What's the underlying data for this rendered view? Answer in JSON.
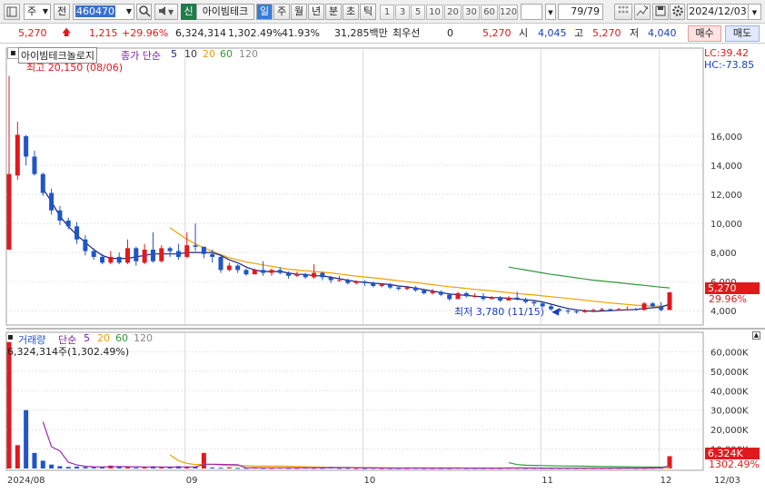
{
  "toolbar": {
    "market": "주",
    "prev": "전",
    "code": "460470",
    "credit": "신",
    "name": "아이빔테크",
    "periods": [
      "일",
      "주",
      "월",
      "년",
      "분",
      "초",
      "틱"
    ],
    "active_period": "일",
    "intervals": [
      "1",
      "3",
      "5",
      "10",
      "20",
      "30",
      "60",
      "120"
    ],
    "count": "79",
    "total": "/79",
    "date": "2024/12/03",
    "colors": {
      "accent": "#1a6fd8",
      "period_active": "#3b7bd6"
    }
  },
  "quote": {
    "price": "5,270",
    "change": "1,215",
    "change_pct": "+29.96%",
    "volume": "6,324,314",
    "volume_pct": "1,302.49%",
    "turnover": "41.93%",
    "amount": "31,285백만",
    "pref_label": "최우선",
    "pref_value": "0",
    "ask": "5,270",
    "open_label": "시",
    "open": "4,045",
    "high_label": "고",
    "high": "5,270",
    "low_label": "저",
    "low": "4,040",
    "buy": "매수",
    "sell": "매도"
  },
  "price_panel": {
    "title": "아이빔테크놀로지",
    "ma_label": "종가 단순",
    "ma_periods": [
      "5",
      "10",
      "20",
      "60",
      "120"
    ],
    "high_note": "최고 20,150 (08/06)",
    "low_note": "최저 3,780 (11/15)",
    "lc": "LC:39.42",
    "hc": "HC:-73.85",
    "price_tag": "5,270",
    "pct_tag": "29.96%",
    "yticks": [
      "16,000",
      "14,000",
      "12,000",
      "10,000",
      "8,000",
      "6,000",
      "4,000"
    ]
  },
  "volume_panel": {
    "title": "거래량",
    "ma_label": "단순",
    "ma_periods": [
      "5",
      "20",
      "60",
      "120"
    ],
    "value_note": "6,324,314주(1,302.49%)",
    "vol_tag": "6,324K",
    "pct_tag": "1302.49%",
    "yticks": [
      "60,000K",
      "50,000K",
      "40,000K",
      "30,000K",
      "20,000K",
      "10,000K"
    ]
  },
  "xaxis": {
    "labels": [
      "2024/08",
      "09",
      "10",
      "11",
      "12",
      "12/03"
    ]
  },
  "chart_data": {
    "type": "candlestick",
    "x_range": [
      "2024/08",
      "2024/12/03"
    ],
    "ylim": [
      3200,
      21000
    ],
    "colors": {
      "up": "#e1191d",
      "down": "#1f55c7",
      "ma5": "#1a237e",
      "ma20": "#f0a000",
      "ma60": "#2e9a3a"
    },
    "candles": [
      [
        8200,
        13400,
        8200,
        20150
      ],
      [
        13300,
        16100,
        13000,
        17000
      ],
      [
        16000,
        14600,
        14000,
        16100
      ],
      [
        14600,
        13400,
        13300,
        15000
      ],
      [
        13400,
        12100,
        11900,
        13500
      ],
      [
        12100,
        10900,
        10600,
        12400
      ],
      [
        10900,
        10200,
        9900,
        11200
      ],
      [
        10200,
        9800,
        9600,
        10400
      ],
      [
        9800,
        8900,
        8600,
        10100
      ],
      [
        8900,
        8100,
        7800,
        9200
      ],
      [
        8100,
        7700,
        7500,
        8300
      ],
      [
        7700,
        7300,
        7200,
        7900
      ],
      [
        7300,
        7700,
        7200,
        8100
      ],
      [
        7700,
        7300,
        7200,
        8000
      ],
      [
        7300,
        8300,
        7200,
        8900
      ],
      [
        8300,
        7400,
        7100,
        8400
      ],
      [
        7300,
        8200,
        7200,
        8600
      ],
      [
        8200,
        7400,
        7300,
        9400
      ],
      [
        7400,
        8300,
        7300,
        8500
      ],
      [
        8300,
        8100,
        7700,
        8400
      ],
      [
        8100,
        7700,
        7500,
        8600
      ],
      [
        7700,
        8500,
        7600,
        9400
      ],
      [
        8500,
        8400,
        8100,
        10000
      ],
      [
        8400,
        7900,
        7600,
        8400
      ],
      [
        7900,
        7700,
        7300,
        8200
      ],
      [
        7700,
        6800,
        6600,
        7900
      ],
      [
        6800,
        7100,
        6700,
        7300
      ],
      [
        7100,
        6800,
        6600,
        7200
      ],
      [
        6800,
        6500,
        6400,
        6900
      ],
      [
        6500,
        6800,
        6500,
        6900
      ],
      [
        6800,
        6600,
        6400,
        7400
      ],
      [
        6600,
        6800,
        6400,
        6900
      ],
      [
        6800,
        6600,
        6500,
        7000
      ],
      [
        6600,
        6400,
        6200,
        6700
      ],
      [
        6400,
        6500,
        6300,
        6700
      ],
      [
        6500,
        6300,
        6200,
        6600
      ],
      [
        6300,
        6600,
        6200,
        7200
      ],
      [
        6600,
        6300,
        6100,
        6700
      ],
      [
        6300,
        6100,
        5900,
        6400
      ],
      [
        6100,
        6100,
        6000,
        6400
      ],
      [
        6100,
        5900,
        5800,
        6200
      ],
      [
        5900,
        6000,
        5800,
        6100
      ],
      [
        6000,
        5900,
        5700,
        6100
      ],
      [
        5900,
        5700,
        5600,
        6000
      ],
      [
        5700,
        5800,
        5600,
        5900
      ],
      [
        5800,
        5600,
        5500,
        5900
      ],
      [
        5600,
        5500,
        5400,
        5700
      ],
      [
        5500,
        5600,
        5400,
        5700
      ],
      [
        5600,
        5400,
        5300,
        5700
      ],
      [
        5400,
        5200,
        5100,
        5500
      ],
      [
        5200,
        5300,
        5100,
        5500
      ],
      [
        5300,
        5100,
        5000,
        5400
      ],
      [
        5100,
        4800,
        4700,
        5200
      ],
      [
        4800,
        5200,
        4800,
        5300
      ],
      [
        5200,
        5000,
        4900,
        5300
      ],
      [
        5000,
        5000,
        4900,
        5200
      ],
      [
        5000,
        4800,
        4700,
        5200
      ],
      [
        4800,
        4900,
        4800,
        5000
      ],
      [
        4900,
        4700,
        4600,
        5000
      ],
      [
        4700,
        4900,
        4700,
        5000
      ],
      [
        4900,
        4800,
        4700,
        5300
      ],
      [
        4800,
        4600,
        4500,
        4900
      ],
      [
        4600,
        4500,
        4300,
        4700
      ],
      [
        4500,
        4300,
        4200,
        4600
      ],
      [
        4300,
        4100,
        4000,
        4400
      ],
      [
        4100,
        4000,
        3900,
        4200
      ],
      [
        4000,
        3950,
        3780,
        4100
      ],
      [
        3950,
        3900,
        3800,
        4000
      ],
      [
        3900,
        4000,
        3850,
        4100
      ],
      [
        4000,
        4050,
        3950,
        4150
      ],
      [
        4050,
        4100,
        4000,
        4200
      ],
      [
        4100,
        4050,
        4000,
        4150
      ],
      [
        4050,
        4100,
        4000,
        4200
      ],
      [
        4100,
        4100,
        4000,
        4300
      ],
      [
        4100,
        4050,
        4000,
        4200
      ],
      [
        4050,
        4500,
        4000,
        4600
      ],
      [
        4500,
        4300,
        4200,
        4600
      ],
      [
        4300,
        4050,
        3950,
        4600
      ],
      [
        4045,
        5270,
        4040,
        5270
      ]
    ],
    "ma5": [
      null,
      null,
      null,
      null,
      12400,
      11500,
      10500,
      9800,
      9200,
      8700,
      8200,
      7800,
      7600,
      7600,
      7600,
      7700,
      7800,
      7900,
      7900,
      7900,
      7900,
      8000,
      8000,
      8000,
      8000,
      7800,
      7500,
      7300,
      7000,
      6800,
      6700,
      6700,
      6700,
      6600,
      6500,
      6500,
      6400,
      6400,
      6300,
      6200,
      6100,
      6000,
      5950,
      5900,
      5850,
      5800,
      5700,
      5650,
      5550,
      5450,
      5350,
      5250,
      5150,
      5100,
      5050,
      5000,
      4950,
      4900,
      4900,
      4850,
      4800,
      4750,
      4700,
      4600,
      4450,
      4300,
      4150,
      4050,
      4000,
      3950,
      3980,
      4000,
      4030,
      4060,
      4080,
      4150,
      4200,
      4250,
      4450
    ],
    "ma20": [
      null,
      null,
      null,
      null,
      null,
      null,
      null,
      null,
      null,
      null,
      null,
      null,
      null,
      null,
      null,
      null,
      null,
      null,
      null,
      9700,
      9300,
      8900,
      8600,
      8300,
      8100,
      7850,
      7650,
      7500,
      7350,
      7250,
      7150,
      7050,
      6950,
      6850,
      6800,
      6750,
      6700,
      6650,
      6600,
      6520,
      6450,
      6380,
      6320,
      6260,
      6200,
      6130,
      6060,
      6000,
      5930,
      5860,
      5790,
      5720,
      5650,
      5590,
      5530,
      5470,
      5420,
      5360,
      5300,
      5240,
      5180,
      5130,
      5080,
      5020,
      4960,
      4900,
      4840,
      4780,
      4720,
      4650,
      4590,
      4530,
      4480,
      4430,
      4380,
      4340,
      4320,
      4320,
      4380
    ],
    "ma60": [
      null,
      null,
      null,
      null,
      null,
      null,
      null,
      null,
      null,
      null,
      null,
      null,
      null,
      null,
      null,
      null,
      null,
      null,
      null,
      null,
      null,
      null,
      null,
      null,
      null,
      null,
      null,
      null,
      null,
      null,
      null,
      null,
      null,
      null,
      null,
      null,
      null,
      null,
      null,
      null,
      null,
      null,
      null,
      null,
      null,
      null,
      null,
      null,
      null,
      null,
      null,
      null,
      null,
      null,
      null,
      null,
      null,
      null,
      null,
      7000,
      6900,
      6800,
      6700,
      6600,
      6500,
      6420,
      6340,
      6260,
      6180,
      6100,
      6040,
      5980,
      5920,
      5860,
      5800,
      5740,
      5680,
      5620,
      5570
    ],
    "volume": {
      "ylim": [
        0,
        70000
      ],
      "values": [
        65000,
        12000,
        30000,
        8000,
        4000,
        2000,
        1200,
        800,
        1000,
        700,
        600,
        800,
        1500,
        800,
        700,
        400,
        600,
        1100,
        600,
        500,
        1200,
        700,
        800,
        8000,
        500,
        400,
        600,
        300,
        300,
        400,
        300,
        300,
        400,
        300,
        300,
        400,
        300,
        300,
        800,
        300,
        300,
        200,
        200,
        300,
        200,
        200,
        200,
        200,
        300,
        200,
        200,
        200,
        200,
        300,
        200,
        200,
        200,
        200,
        200,
        300,
        300,
        200,
        200,
        200,
        200,
        200,
        200,
        200,
        200,
        200,
        200,
        200,
        200,
        300,
        200,
        200,
        300,
        400,
        6324
      ],
      "ma5": [
        null,
        null,
        null,
        null,
        24000,
        11200,
        9000,
        3200,
        1800,
        1100,
        900,
        800,
        950,
        1000,
        900,
        900,
        800,
        800,
        800,
        700,
        800,
        800,
        800,
        2200,
        2200,
        2100,
        2000,
        1900,
        300,
        400,
        350,
        330,
        340,
        330,
        320,
        340,
        330,
        320,
        440,
        420,
        400,
        360,
        300,
        280,
        220,
        210,
        200,
        210,
        220,
        210,
        210,
        200,
        210,
        220,
        210,
        210,
        200,
        210,
        210,
        220,
        230,
        230,
        220,
        210,
        200,
        200,
        200,
        200,
        200,
        200,
        200,
        200,
        210,
        210,
        210,
        210,
        240,
        280,
        1500
      ],
      "ma20": [
        null,
        null,
        null,
        null,
        null,
        null,
        null,
        null,
        null,
        null,
        null,
        null,
        null,
        null,
        null,
        null,
        null,
        null,
        null,
        7000,
        4000,
        2600,
        2000,
        2200,
        2000,
        1800,
        1600,
        1500,
        1400,
        1300,
        1200,
        1200,
        1200,
        1100,
        1000,
        900,
        800,
        700,
        600,
        550,
        500,
        450,
        420,
        400,
        380,
        360,
        340,
        320,
        300,
        290,
        280,
        270,
        260,
        255,
        250,
        245,
        240,
        235,
        230,
        225,
        220,
        215,
        210,
        205,
        200,
        200,
        200,
        200,
        200,
        200,
        200,
        200,
        200,
        210,
        210,
        210,
        220,
        230,
        520
      ],
      "ma60": [
        null,
        null,
        null,
        null,
        null,
        null,
        null,
        null,
        null,
        null,
        null,
        null,
        null,
        null,
        null,
        null,
        null,
        null,
        null,
        null,
        null,
        null,
        null,
        null,
        null,
        null,
        null,
        null,
        null,
        null,
        null,
        null,
        null,
        null,
        null,
        null,
        null,
        null,
        null,
        null,
        null,
        null,
        null,
        null,
        null,
        null,
        null,
        null,
        null,
        null,
        null,
        null,
        null,
        null,
        null,
        null,
        null,
        null,
        null,
        3000,
        2000,
        1700,
        1600,
        1500,
        1400,
        1300,
        1250,
        1200,
        1150,
        1100,
        1050,
        1000,
        950,
        900,
        850,
        800,
        760,
        720,
        700
      ]
    },
    "vol_up": [
      true,
      true,
      false,
      false,
      false,
      false,
      false,
      false,
      false,
      false,
      false,
      false,
      true,
      false,
      true,
      false,
      true,
      false,
      true,
      false,
      false,
      true,
      false,
      true,
      false,
      false,
      true,
      false,
      false,
      true,
      false,
      true,
      false,
      false,
      true,
      false,
      true,
      false,
      false,
      false,
      false,
      true,
      false,
      false,
      true,
      false,
      false,
      true,
      false,
      false,
      true,
      false,
      false,
      true,
      false,
      false,
      false,
      true,
      false,
      true,
      false,
      false,
      false,
      false,
      false,
      false,
      false,
      false,
      true,
      true,
      true,
      false,
      true,
      false,
      false,
      true,
      false,
      false,
      true
    ]
  }
}
